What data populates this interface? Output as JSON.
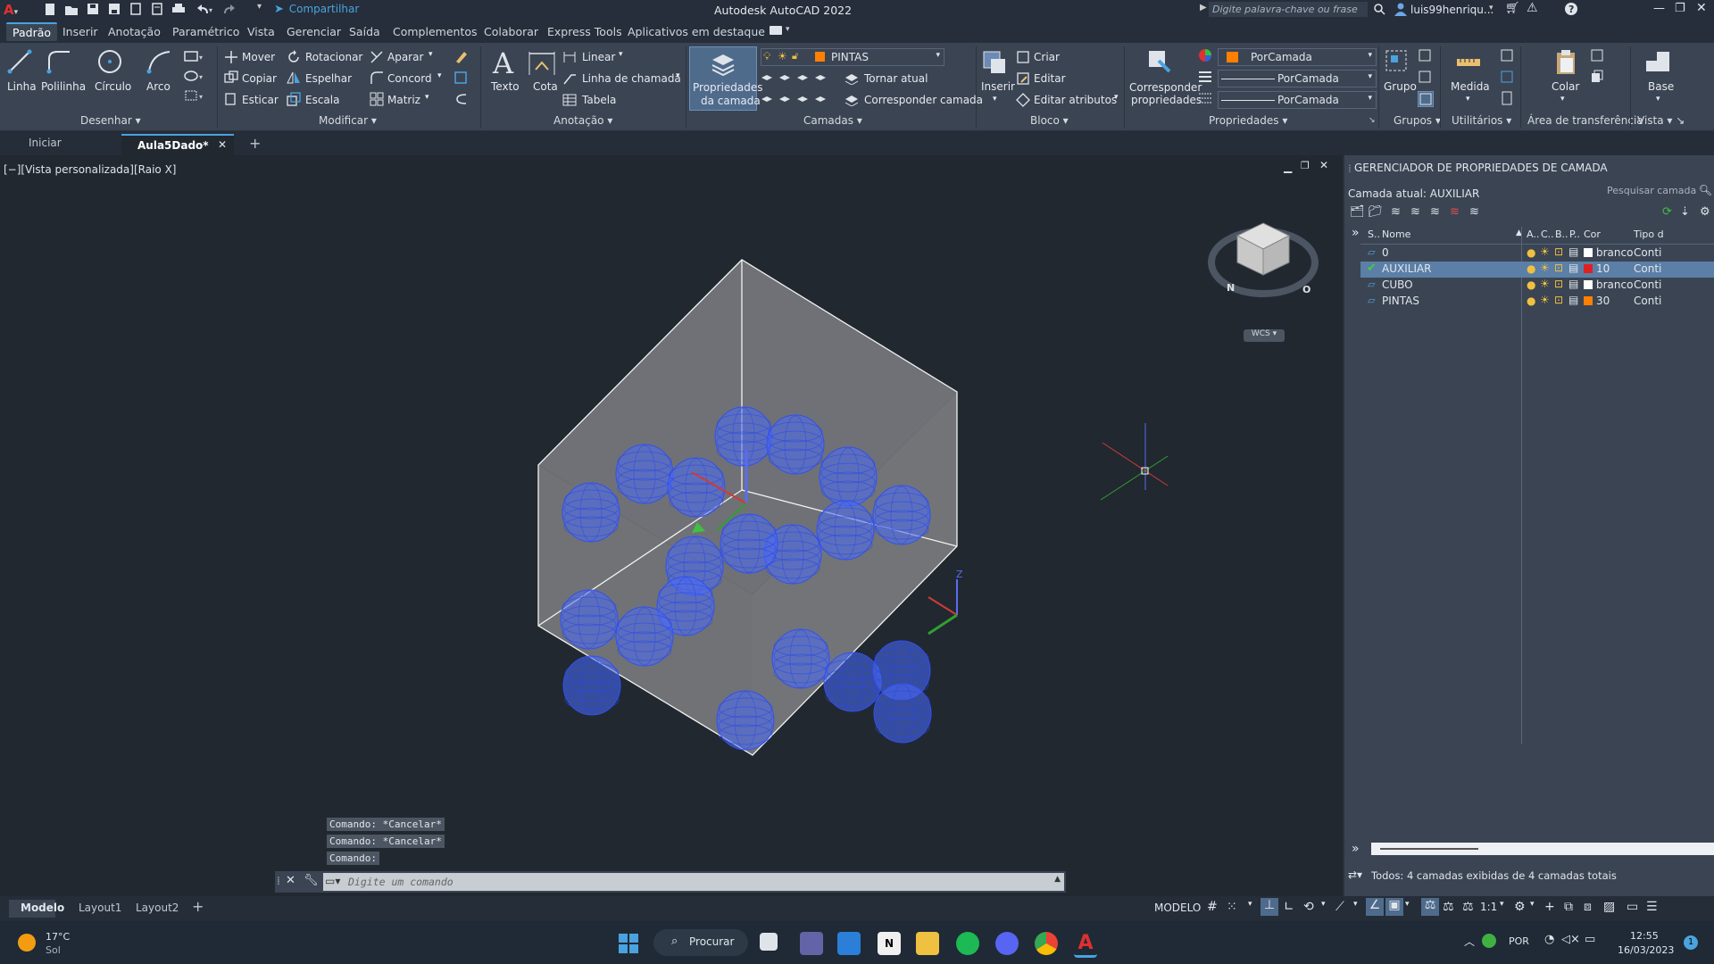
{
  "app": {
    "title": "Autodesk AutoCAD 2022",
    "share_label": "Compartilhar",
    "search_placeholder": "Digite palavra-chave ou frase",
    "user": "luis99henriqu..."
  },
  "menu_tabs": [
    "Padrão",
    "Inserir",
    "Anotação",
    "Paramétrico",
    "Vista",
    "Gerenciar",
    "Saída",
    "Complementos",
    "Colaborar",
    "Express Tools",
    "Aplicativos em destaque"
  ],
  "ribbon": {
    "draw": {
      "title": "Desenhar",
      "line": "Linha",
      "polyline": "Polilinha",
      "circle": "Círculo",
      "arc": "Arco"
    },
    "modify": {
      "title": "Modificar",
      "move": "Mover",
      "rotate": "Rotacionar",
      "trim": "Aparar",
      "copy": "Copiar",
      "mirror": "Espelhar",
      "fillet": "Concord",
      "stretch": "Esticar",
      "scale": "Escala",
      "array": "Matriz"
    },
    "annotation": {
      "title": "Anotação",
      "text": "Texto",
      "dimension": "Cota",
      "linear": "Linear",
      "leader": "Linha de chamada",
      "table": "Tabela"
    },
    "layers": {
      "title": "Camadas",
      "props_line1": "Propriedades",
      "props_line2": "da camada",
      "current_layer": "PINTAS",
      "make_current": "Tornar atual",
      "match_layer": "Corresponder camada"
    },
    "block": {
      "title": "Bloco",
      "insert": "Inserir",
      "create": "Criar",
      "edit": "Editar",
      "edit_attrs": "Editar atributos"
    },
    "properties": {
      "title": "Propriedades",
      "match_line1": "Corresponder",
      "match_line2": "propriedades",
      "color": "PorCamada",
      "linetype": "PorCamada",
      "lineweight": "PorCamada"
    },
    "groups": {
      "title": "Grupos",
      "group": "Grupo"
    },
    "utilities": {
      "title": "Utilitários",
      "measure": "Medida"
    },
    "clipboard": {
      "title": "Área de transferência",
      "paste": "Colar"
    },
    "view": {
      "title": "Vista",
      "base": "Base"
    }
  },
  "doc_tabs": [
    "Iniciar",
    "Aula5Dado*"
  ],
  "viewport": {
    "label": "[−][Vista personalizada][Raio X]",
    "wcs": "WCS",
    "viewcube_n": "N",
    "viewcube_o": "O"
  },
  "command": {
    "history": [
      "Comando: *Cancelar*",
      "Comando: *Cancelar*",
      "Comando:"
    ],
    "placeholder": "Digite um comando"
  },
  "layer_manager": {
    "title": "GERENCIADOR DE PROPRIEDADES DE CAMADA",
    "current": "Camada atual: AUXILIAR",
    "search_placeholder": "Pesquisar camada",
    "columns": [
      "S..",
      "Nome",
      "A..",
      "C..",
      "B..",
      "P..",
      "Cor",
      "Tipo d"
    ],
    "layers": [
      {
        "name": "0",
        "color_name": "branco",
        "color": "#ffffff",
        "linetype": "Conti"
      },
      {
        "name": "AUXILIAR",
        "color_name": "10",
        "color": "#e02020",
        "linetype": "Conti"
      },
      {
        "name": "CUBO",
        "color_name": "branco",
        "color": "#ffffff",
        "linetype": "Conti"
      },
      {
        "name": "PINTAS",
        "color_name": "30",
        "color": "#ff8000",
        "linetype": "Conti"
      }
    ],
    "footer": "Todos: 4 camadas exibidas de 4 camadas totais"
  },
  "status": {
    "layout_tabs": [
      "Modelo",
      "Layout1",
      "Layout2"
    ],
    "model_label": "MODELO",
    "scale": "1:1"
  },
  "taskbar": {
    "weather_temp": "17°C",
    "weather_desc": "Sol",
    "search_label": "Procurar",
    "lang": "POR",
    "time": "12:55",
    "date": "16/03/2023",
    "notif": "1"
  },
  "colors": {
    "accent": "#4aa3df",
    "sphere": "#4a6cf7",
    "selected_row": "#5b7fa6"
  }
}
